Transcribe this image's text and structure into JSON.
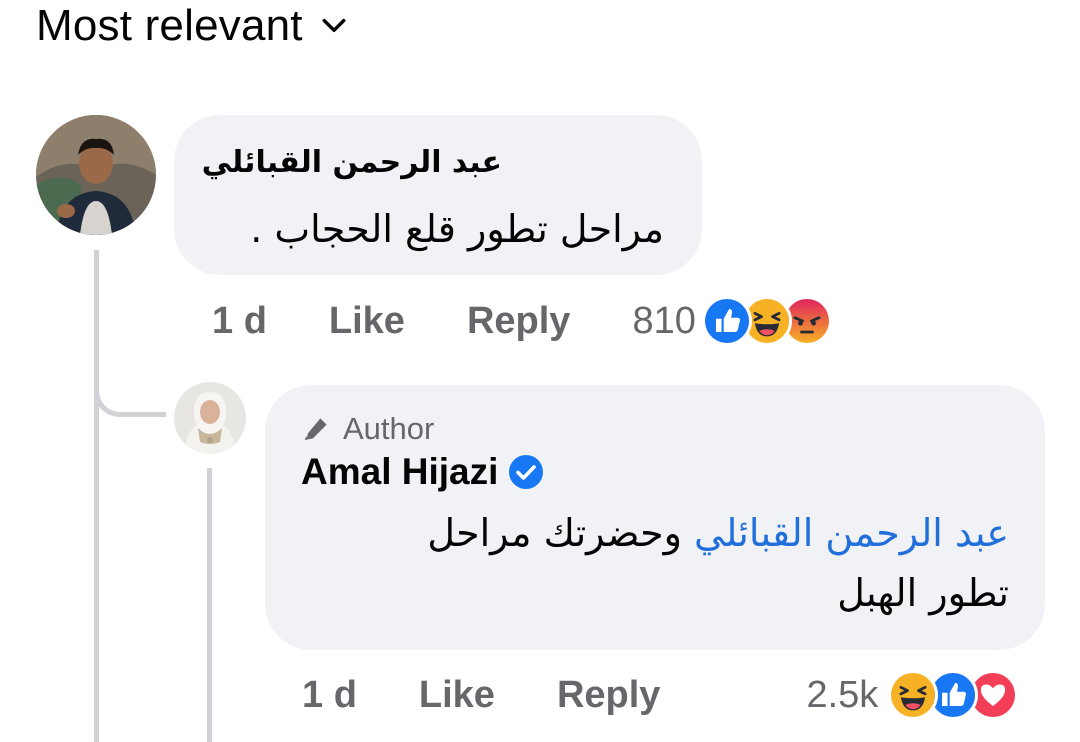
{
  "sort": {
    "label": "Most relevant",
    "icon": "chevron-down-icon"
  },
  "comments": [
    {
      "author": "عبد الرحمن القبائلي",
      "text": "مراحل تطور قلع الحجاب .",
      "time": "1 d",
      "like_label": "Like",
      "reply_label": "Reply",
      "reaction_count": "810",
      "reactions": [
        "like-reaction-icon",
        "haha-reaction-icon",
        "angry-reaction-icon"
      ]
    },
    {
      "badge": "Author",
      "badge_icon": "pencil-icon",
      "author": "Amal Hijazi",
      "verified": true,
      "mention": "عبد الرحمن القبائلي",
      "text": "وحضرتك مراحل تطور الهبل",
      "time": "1 d",
      "like_label": "Like",
      "reply_label": "Reply",
      "reaction_count": "2.5k",
      "reactions": [
        "haha-reaction-icon",
        "like-reaction-icon",
        "love-reaction-icon"
      ]
    }
  ],
  "colors": {
    "bubble": "#f0f2f5",
    "meta_text": "#65676b",
    "mention": "#216fdb",
    "like_blue": "#1877f2",
    "love_red": "#f33e58",
    "haha_yellow": "#f7b125",
    "angry_orange": "#e9710f"
  }
}
